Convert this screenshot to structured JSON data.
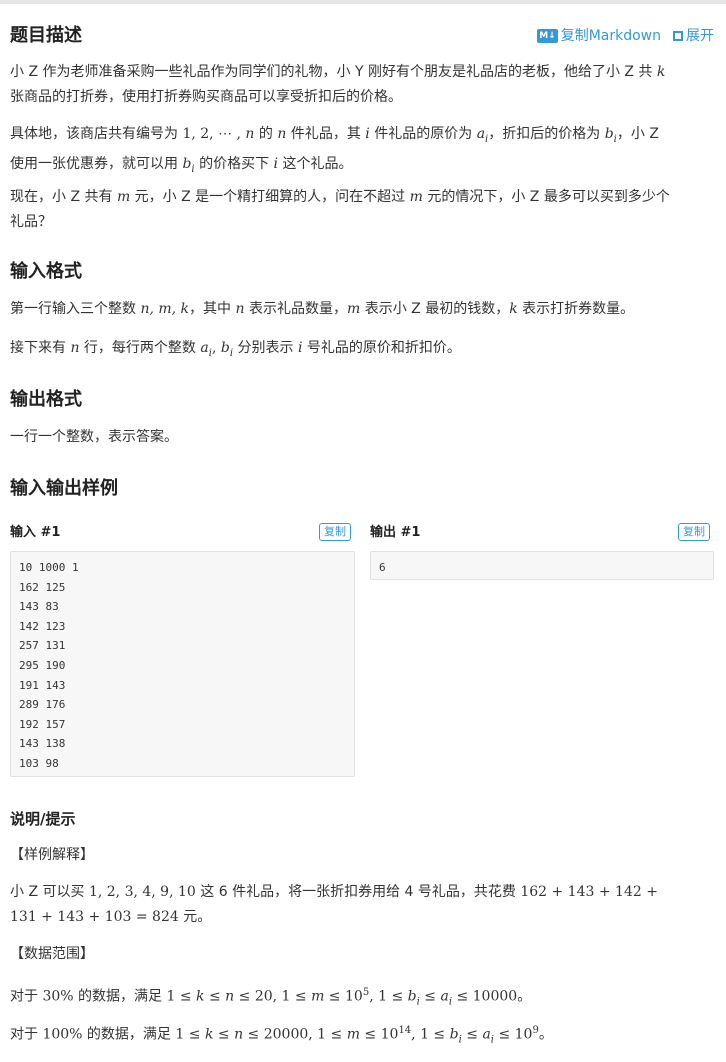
{
  "header": {
    "title": "题目描述",
    "copy_markdown": "复制Markdown",
    "expand": "展开",
    "md_badge": "M↓"
  },
  "desc": {
    "p1": {
      "a": "小 Z 作为老师准备采购一些礼品作为同学们的礼物，小 Y 刚好有个朋友是礼品店的老板，他给了小 Z 共 ",
      "k": "k",
      "b": "张商品的打折券，使用打折券购买商品可以享受折扣后的价格。"
    },
    "p2": {
      "a": "具体地，该商店共有编号为 ",
      "seq": "1, 2, ⋯ , ",
      "n": "n",
      "b": " 的 ",
      "c": " 件礼品，其 ",
      "i": "i",
      "d": " 件礼品的原价为 ",
      "ai": "a",
      "sub_i": "i",
      "e": "，折扣后的价格为 ",
      "bi": "b",
      "f": "，小 Z",
      "g": "使用一张优惠券，就可以用 ",
      "h": " 的价格买下 ",
      "j": " 这个礼品。"
    },
    "p3": {
      "a": "现在，小 Z 共有 ",
      "m": "m",
      "b": " 元，小 Z 是一个精打细算的人，问在不超过 ",
      "c": " 元的情况下，小 Z 最多可以买到多少个",
      "d": "礼品？"
    }
  },
  "input": {
    "title": "输入格式",
    "p1": {
      "a": "第一行输入三个整数 ",
      "vars": "n, m, k",
      "b": "，其中 ",
      "c": " 表示礼品数量，",
      "d": " 表示小 Z 最初的钱数，",
      "e": " 表示打折券数量。"
    },
    "p2": {
      "a": "接下来有 ",
      "b": " 行，每行两个整数 ",
      "c": " 分别表示 ",
      "d": " 号礼品的原价和折扣价。"
    }
  },
  "output": {
    "title": "输出格式",
    "p1": "一行一个整数，表示答案。"
  },
  "samples": {
    "title": "输入输出样例",
    "in_label": "输入 #1",
    "out_label": "输出 #1",
    "copy": "复制",
    "in_text": "10 1000 1\n162 125\n143 83\n142 123\n257 131\n295 190\n191 143\n289 176\n192 157\n143 138\n103 98",
    "out_text": "6"
  },
  "hint": {
    "title": "说明/提示",
    "explain_tag": "【样例解释】",
    "explain": {
      "a": "小 Z 可以买 ",
      "list": "1, 2, 3, 4, 9, 10",
      "b": " 这 6 件礼品，将一张折扣券用给 4 号礼品，共花费 ",
      "sum1": "162 + 143 + 142 +",
      "sum2": "131 + 143 + 103 = 824",
      "c": " 元。"
    },
    "range_tag": "【数据范围】",
    "r1": {
      "a": "对于 ",
      "pct": "30%",
      "b": " 的数据，满足 ",
      "c1": "1 ≤ ",
      "c2": " ≤ ",
      "c3": " ≤ 20, 1 ≤ ",
      "c4": " ≤ 10",
      "exp": "5",
      "c5": ", 1 ≤ ",
      "c6": " ≤ ",
      "c7": " ≤ 10000",
      "d": "。"
    },
    "r2": {
      "a": "对于 ",
      "pct": "100%",
      "b": " 的数据，满足 ",
      "c1": "1 ≤ ",
      "c2": " ≤ ",
      "c3": " ≤ 20000, 1 ≤ ",
      "c4": " ≤ 10",
      "exp": "14",
      "c5": ", 1 ≤ ",
      "c6": " ≤ ",
      "c7": " ≤ 10",
      "exp2": "9",
      "d": "。"
    }
  }
}
